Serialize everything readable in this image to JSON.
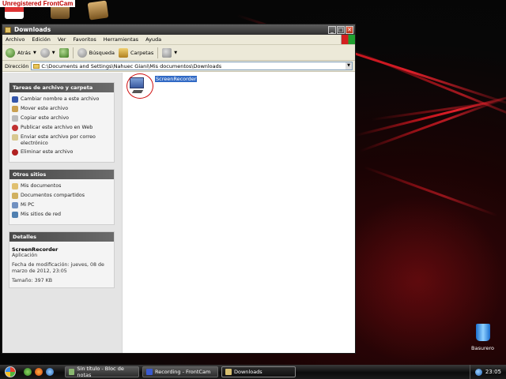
{
  "desktop": {
    "watermark": "Unregistered FrontCam",
    "recycle_bin_label": "Basurero"
  },
  "window": {
    "title": "Downloads",
    "buttons": {
      "minimize": "_",
      "maximize": "□",
      "close": "✕"
    }
  },
  "menu": {
    "items": [
      "Archivo",
      "Edición",
      "Ver",
      "Favoritos",
      "Herramientas",
      "Ayuda"
    ]
  },
  "toolbar": {
    "back": "Atrás",
    "search": "Búsqueda",
    "folders": "Carpetas"
  },
  "address": {
    "label": "Dirección",
    "value": "C:\\Documents and Settings\\Nahuec Giani\\Mis documentos\\Downloads"
  },
  "panels": {
    "tasks": {
      "title": "Tareas de archivo y carpeta",
      "items": [
        "Cambiar nombre a este archivo",
        "Mover este archivo",
        "Copiar este archivo",
        "Publicar este archivo en Web",
        "Enviar este archivo por correo electrónico",
        "Eliminar este archivo"
      ]
    },
    "places": {
      "title": "Otros sitios",
      "items": [
        "Mis documentos",
        "Documentos compartidos",
        "Mi PC",
        "Mis sitios de red"
      ]
    },
    "details": {
      "title": "Detalles",
      "name": "ScreenRecorder",
      "type": "Aplicación",
      "modified": "Fecha de modificación: jueves, 08 de marzo de 2012, 23:05",
      "size": "Tamaño: 397 KB"
    }
  },
  "files": [
    {
      "name": "ScreenRecorder"
    }
  ],
  "taskbar": {
    "buttons": [
      "Sin título - Bloc de notas",
      "Recording - FrontCam",
      "Downloads"
    ],
    "active_index": 2,
    "clock": "23:05"
  },
  "colors": {
    "selection": "#316ac5",
    "panel_header": "#4a4a4a",
    "wallpaper_accent": "#c0141c"
  }
}
